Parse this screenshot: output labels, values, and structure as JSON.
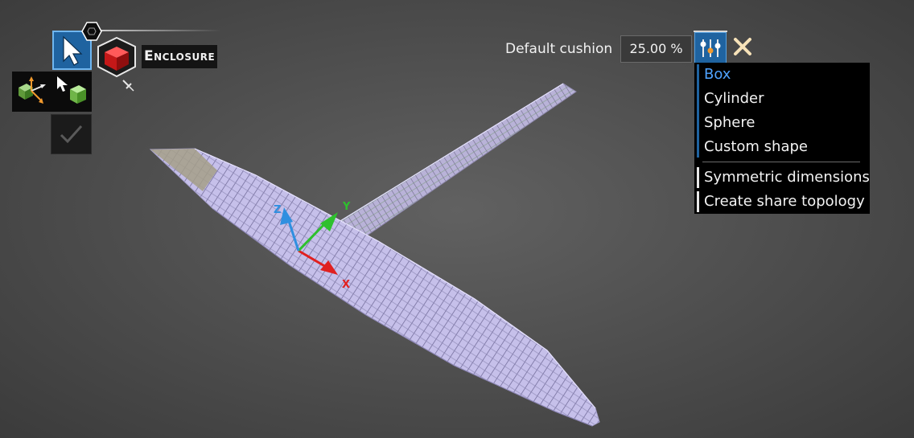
{
  "toolbar": {
    "mode_label": "Enclosure"
  },
  "cushion": {
    "label": "Default cushion",
    "value": "25.00 %"
  },
  "shape_menu": {
    "items": [
      {
        "label": "Box",
        "selected": true
      },
      {
        "label": "Cylinder",
        "selected": false
      },
      {
        "label": "Sphere",
        "selected": false
      },
      {
        "label": "Custom shape",
        "selected": false
      }
    ],
    "options": [
      {
        "label": "Symmetric dimensions"
      },
      {
        "label": "Create share topology"
      }
    ]
  },
  "triad": {
    "x_label": "X",
    "y_label": "Y",
    "z_label": "Z"
  },
  "colors": {
    "accent": "#1f63a0",
    "selected_text": "#4fa3ff",
    "menu_bg": "#000000",
    "model_wire": "#c9c3ee",
    "axis_x": "#e02020",
    "axis_y": "#2ec02e",
    "axis_z": "#2f8fe0"
  },
  "icons": [
    "select-arrow-icon",
    "hexagon-badge-icon",
    "enclosure-box-icon",
    "pin-icon",
    "move-cube-icon",
    "select-cube-icon",
    "checkmark-icon",
    "options-sliders-icon",
    "close-icon"
  ]
}
